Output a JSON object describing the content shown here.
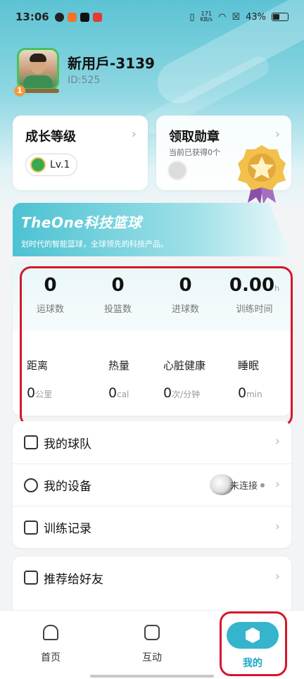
{
  "status_bar": {
    "time": "13:06",
    "speed_value": "171",
    "speed_unit": "KB/s",
    "battery": "43%"
  },
  "profile": {
    "username": "新用戶-3139",
    "user_id": "ID:525",
    "avatar_level": "1"
  },
  "level_card": {
    "title": "成长等级",
    "level": "Lv.1"
  },
  "medal_card": {
    "title": "领取勋章",
    "subtitle": "当前已获得0个"
  },
  "banner": {
    "title": "TheOne科技篮球",
    "subtitle": "划时代的智能篮球，全球领先的科技产品。"
  },
  "stats": [
    {
      "value": "0",
      "unit": "",
      "label": "运球数"
    },
    {
      "value": "0",
      "unit": "",
      "label": "投篮数"
    },
    {
      "value": "0",
      "unit": "",
      "label": "进球数"
    },
    {
      "value": "0.00",
      "unit": "h",
      "label": "训练时间"
    }
  ],
  "health": [
    {
      "label": "距离",
      "value": "0",
      "unit": "公里"
    },
    {
      "label": "热量",
      "value": "0",
      "unit": "cal"
    },
    {
      "label": "心脏健康",
      "value": "0",
      "unit": "次/分钟"
    },
    {
      "label": "睡眠",
      "value": "0",
      "unit": "min"
    }
  ],
  "menu": {
    "team": "我的球队",
    "device": "我的设备",
    "device_status": "未连接",
    "records": "训练记录",
    "recommend": "推荐给好友"
  },
  "tabbar": {
    "home": "首页",
    "interact": "互动",
    "me": "我的"
  },
  "colors": {
    "accent": "#35b4cc",
    "highlight": "#d5172a",
    "avatar_border": "#47c25a"
  }
}
